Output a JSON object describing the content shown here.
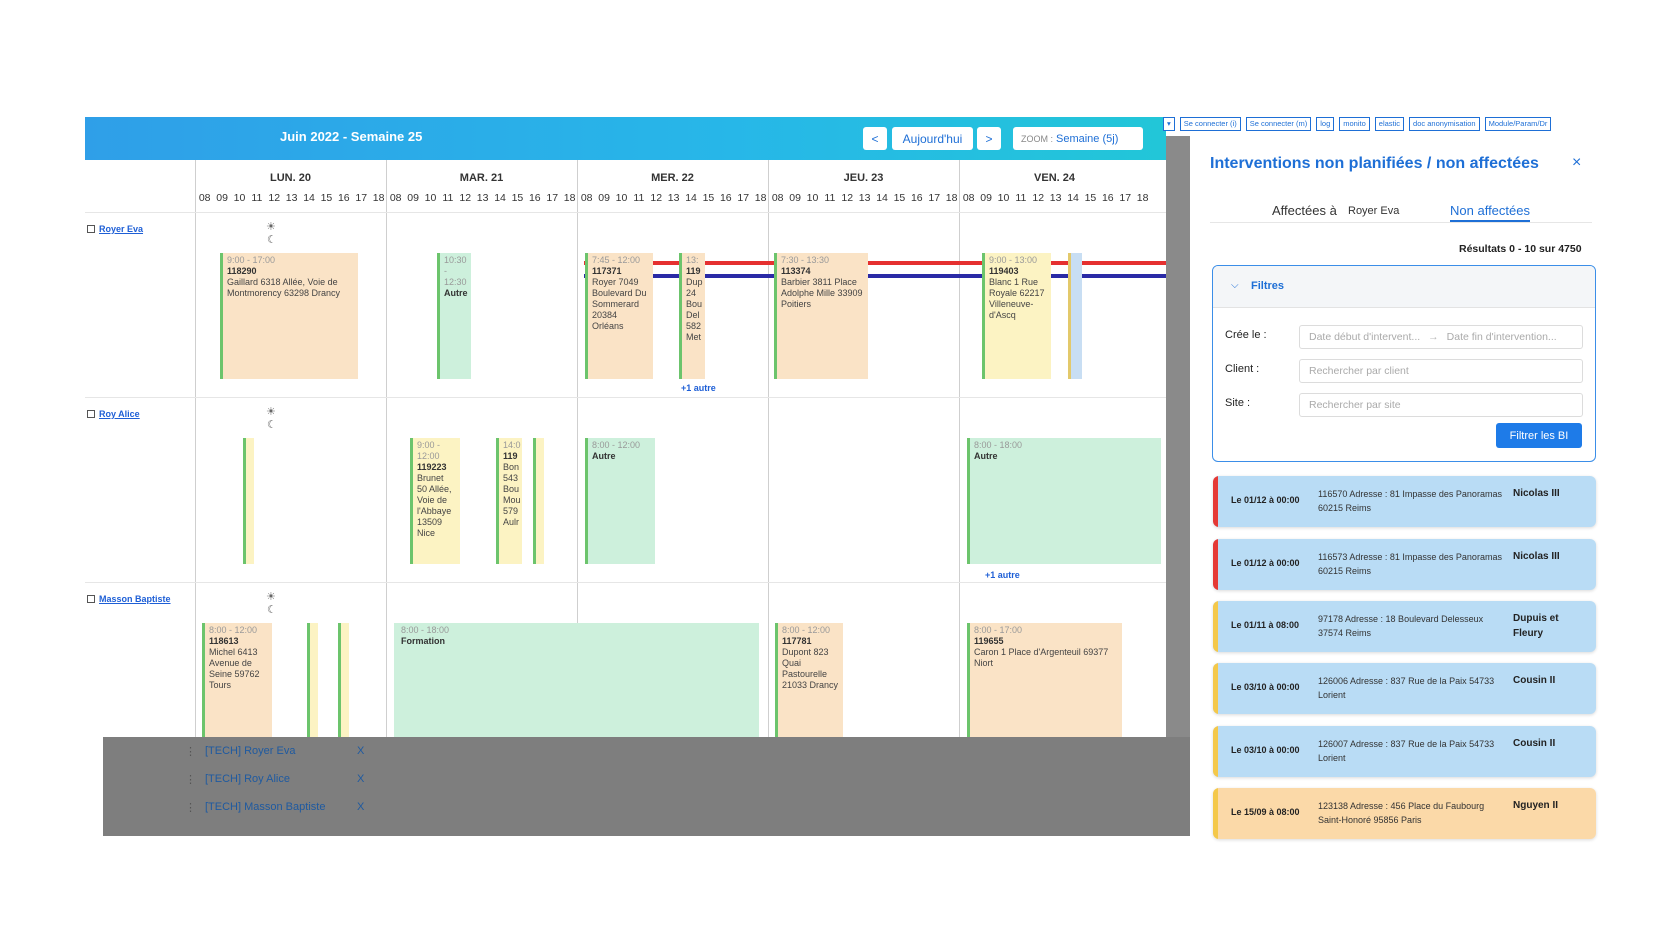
{
  "header": {
    "title": "Juin 2022 - Semaine 25",
    "prev_label": "<",
    "today_label": "Aujourd'hui",
    "next_label": ">",
    "zoom_prefix": "ZOOM :",
    "zoom_value": "Semaine (5j)"
  },
  "days": [
    "LUN. 20",
    "MAR. 21",
    "MER. 22",
    "JEU. 23",
    "VEN. 24"
  ],
  "hours": [
    "08",
    "09",
    "10",
    "11",
    "12",
    "13",
    "14",
    "15",
    "16",
    "17",
    "18"
  ],
  "technicians": [
    "Royer Eva",
    "Roy Alice",
    "Masson Baptiste"
  ],
  "events": {
    "e1": {
      "time": "9:00 - 17:00",
      "id": "118290",
      "text": "Gaillard 6318 Allée, Voie de Montmorency 63298 Drancy"
    },
    "e2": {
      "time": "10:30 - 12:30",
      "text": "Autre"
    },
    "e3": {
      "time": "7:45 - 12:00",
      "id": "117371",
      "text": "Royer 7049 Boulevard Du Sommerard 20384 Orléans"
    },
    "e4": {
      "time": "13:",
      "id": "119",
      "text": "Dup 24 Bou Del 582 Met"
    },
    "e5": {
      "time": "7:30 - 13:30",
      "id": "113374",
      "text": "Barbier 3811 Place Adolphe Mille 33909 Poitiers"
    },
    "e6": {
      "time": "9:00 - 13:00",
      "id": "119403",
      "text": "Blanc 1 Rue Royale 62217 Villeneuve-d'Ascq"
    },
    "e7": {
      "time": "9:00 - 12:00",
      "id": "119223",
      "text": "Brunet 50 Allée, Voie de l'Abbaye 13509 Nice"
    },
    "e8": {
      "time": "14:0",
      "id": "119",
      "text": "Bon 543 Bou Mou 579 Aulr"
    },
    "e9": {
      "time": "8:00 - 12:00",
      "text": "Autre"
    },
    "e10": {
      "time": "8:00 - 18:00",
      "text": "Autre"
    },
    "e11": {
      "time": "8:00 - 12:00",
      "id": "118613",
      "text": "Michel 6413 Avenue de Seine 59762 Tours"
    },
    "e12": {
      "time": "8:00 - 18:00",
      "text": "Formation"
    },
    "e13": {
      "time": "8:00 - 12:00",
      "id": "117781",
      "text": "Dupont 823 Quai Pastourelle 21033 Drancy"
    },
    "e14": {
      "time": "8:00 - 17:00",
      "id": "119655",
      "text": "Caron 1 Place d'Argenteuil 69377 Niort"
    },
    "more1": "+1 autre",
    "more2": "+1 autre"
  },
  "overlay_list": [
    {
      "label": "[TECH] Royer Eva",
      "x": "X"
    },
    {
      "label": "[TECH] Roy Alice",
      "x": "X"
    },
    {
      "label": "[TECH] Masson Baptiste",
      "x": "X"
    }
  ],
  "toolbar": [
    "Se connecter (i)",
    "Se connecter (m)",
    "log",
    "monito",
    "elastic",
    "doc anonymisation",
    "Module/Param/Dr"
  ],
  "panel": {
    "title": "Interventions non planifiées / non affectées",
    "close": "×",
    "tab_affected": "Affectées à",
    "tab_affected_value": "Royer Eva",
    "tab_unassigned": "Non affectées",
    "results": "Résultats 0 - 10 sur 4750",
    "filters": {
      "title": "Filtres",
      "created_label": "Crée le :",
      "date_start_placeholder": "Date début d'intervent...",
      "date_end_placeholder": "Date fin d'intervention...",
      "client_label": "Client :",
      "client_placeholder": "Rechercher par client",
      "site_label": "Site :",
      "site_placeholder": "Rechercher par site",
      "button": "Filtrer les BI"
    },
    "cards": [
      {
        "date": "Le 01/12 à 00:00",
        "address": "116570 Adresse : 81 Impasse des Panoramas 60215 Reims",
        "who": "Nicolas III",
        "bar": "#e53935",
        "bg": "#b9dcf5"
      },
      {
        "date": "Le 01/12 à 00:00",
        "address": "116573 Adresse : 81 Impasse des Panoramas 60215 Reims",
        "who": "Nicolas III",
        "bar": "#e53935",
        "bg": "#b9dcf5"
      },
      {
        "date": "Le 01/11 à 08:00",
        "address": "97178 Adresse : 18 Boulevard Delesseux 37574 Reims",
        "who": "Dupuis et Fleury",
        "bar": "#f4c84a",
        "bg": "#b9dcf5"
      },
      {
        "date": "Le 03/10 à 00:00",
        "address": "126006 Adresse : 837 Rue de la Paix 54733 Lorient",
        "who": "Cousin II",
        "bar": "#f4c84a",
        "bg": "#b9dcf5"
      },
      {
        "date": "Le 03/10 à 00:00",
        "address": "126007 Adresse : 837 Rue de la Paix 54733 Lorient",
        "who": "Cousin II",
        "bar": "#f4c84a",
        "bg": "#b9dcf5"
      },
      {
        "date": "Le 15/09 à 08:00",
        "address": "123138 Adresse : 456 Place du Faubourg Saint-Honoré 95856 Paris",
        "who": "Nguyen II",
        "bar": "#f4c84a",
        "bg": "#fbd9a8"
      }
    ]
  }
}
